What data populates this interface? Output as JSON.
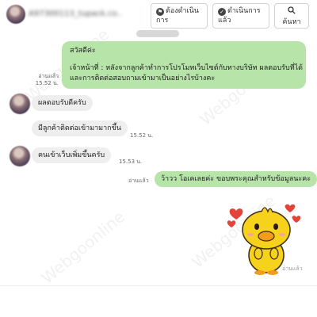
{
  "header": {
    "contact_name": "A97300113_tupack.co..",
    "buttons": [
      {
        "label_line1": "ต้องดำเนิน",
        "label_line2": "การ",
        "icon": "flag-icon"
      },
      {
        "label_line1": "ดำเนินการ",
        "label_line2": "แล้ว",
        "icon": "check-icon"
      },
      {
        "label_line1": "",
        "label_line2": "ค้นหา",
        "icon": "search-icon"
      }
    ]
  },
  "messages": {
    "m1": {
      "greeting": "สวัสดีค่ะ",
      "line1": "เจ้าหน้าที่ : หลังจากลูกค้าทำการโปรโมทเว็บไซต์กับทางบริษัท ผลตอบรับที่ได้",
      "line2": "และการติดต่อสอบถามเข้ามาเป็นอย่างไรบ้างคะ",
      "read": "อ่านแล้ว",
      "time": "15.52 น."
    },
    "m2": {
      "text": "ผลตอบรับดีครับ"
    },
    "m3": {
      "text": "มีลูกค้าติดต่อเข้ามามากขึ้น",
      "time": "15.52 น."
    },
    "m4": {
      "text": "คนเข้าเว็บเพิ่มขึ้นครับ",
      "time": "15.53 น."
    },
    "m5": {
      "text": "ว้าวว โอเคเลยค่ะ ขอบพระคุณสำหรับข้อมูลนะคะ",
      "read": "อ่านแล้ว"
    }
  },
  "footer": {
    "read": "อ่านแล้ว"
  },
  "watermark": "Webgoonline",
  "colors": {
    "outgoing": "#b7e4a8",
    "incoming": "#eeeeee",
    "sticker_body": "#f7d21c",
    "hearts": "#e2443a"
  }
}
